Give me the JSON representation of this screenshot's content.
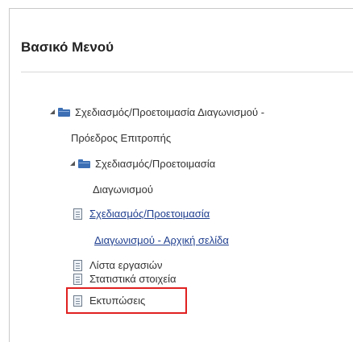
{
  "panel": {
    "title": "Βασικό Μενού"
  },
  "tree": {
    "root": {
      "label_line1": "Σχεδιασμός/Προετοιμασία Διαγωνισμού -",
      "label_line2": "Πρόεδρος Επιτροπής"
    },
    "child": {
      "label_line1": "Σχεδιασμός/Προετοιμασία",
      "label_line2": "Διαγωνισμού"
    },
    "items": [
      {
        "label_line1": "Σχεδιασμός/Προετοιμασία",
        "label_line2": "Διαγωνισμού - Αρχική σελίδα",
        "icon": "page-icon"
      },
      {
        "label": "Λίστα εργασιών",
        "icon": "page-icon"
      },
      {
        "label": "Στατιστικά στοιχεία",
        "icon": "page-icon"
      },
      {
        "label": "Εκτυπώσεις",
        "icon": "page-icon"
      }
    ]
  },
  "colors": {
    "folder": "#3c6fb4",
    "link": "#1f3f8f",
    "highlight": "#e02020"
  }
}
